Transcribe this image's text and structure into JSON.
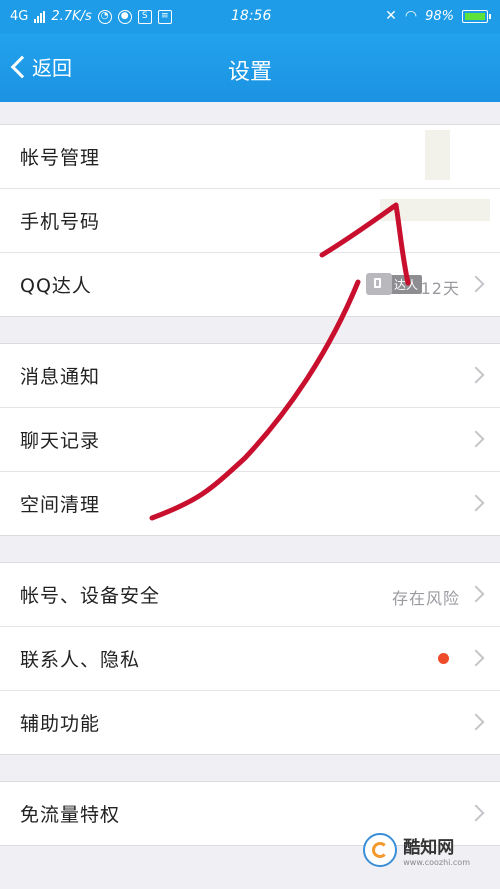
{
  "status_bar": {
    "network": "4G",
    "speed": "2.7K/s",
    "time": "18:56",
    "battery": "98%"
  },
  "header": {
    "back_label": "返回",
    "title": "设置"
  },
  "groups": [
    {
      "rows": [
        {
          "label": "帐号管理"
        },
        {
          "label": "手机号码"
        },
        {
          "label": "QQ达人",
          "badge": "达人",
          "value": "12天"
        }
      ]
    },
    {
      "rows": [
        {
          "label": "消息通知"
        },
        {
          "label": "聊天记录"
        },
        {
          "label": "空间清理"
        }
      ]
    },
    {
      "rows": [
        {
          "label": "帐号、设备安全",
          "value": "存在风险"
        },
        {
          "label": "联系人、隐私"
        },
        {
          "label": "辅助功能"
        }
      ]
    },
    {
      "rows": [
        {
          "label": "免流量特权"
        }
      ]
    }
  ],
  "colors": {
    "accent": "#1e9ce8",
    "red_dot": "#ee4b2b",
    "annotation": "#c8102e"
  },
  "watermark": {
    "name": "酷知网",
    "url": "www.coozhi.com"
  }
}
